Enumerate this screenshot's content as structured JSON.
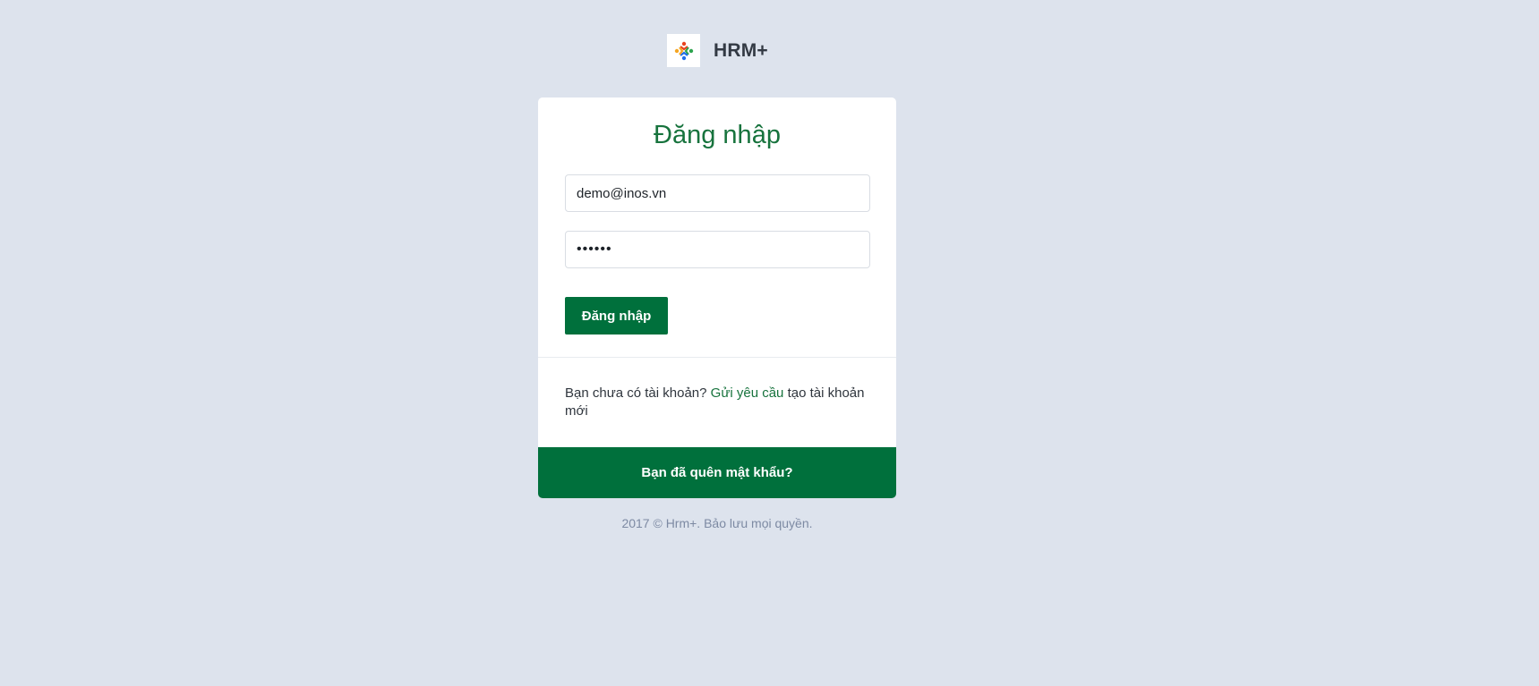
{
  "brand": {
    "name": "HRM+"
  },
  "login": {
    "title": "Đăng nhập",
    "email_value": "demo@inos.vn",
    "password_value": "••••••",
    "submit_label": "Đăng nhập"
  },
  "signup": {
    "prefix": "Bạn chưa có tài khoản?",
    "link_label": "Gửi yêu cầu",
    "suffix": "tạo tài khoản mới"
  },
  "forgot": {
    "label": "Bạn đã quên mật khẩu?"
  },
  "footer": {
    "copyright": "2017 © Hrm+. Bảo lưu mọi quyền."
  },
  "colors": {
    "background": "#dde3ed",
    "accent": "#00703c",
    "title": "#17733d"
  }
}
